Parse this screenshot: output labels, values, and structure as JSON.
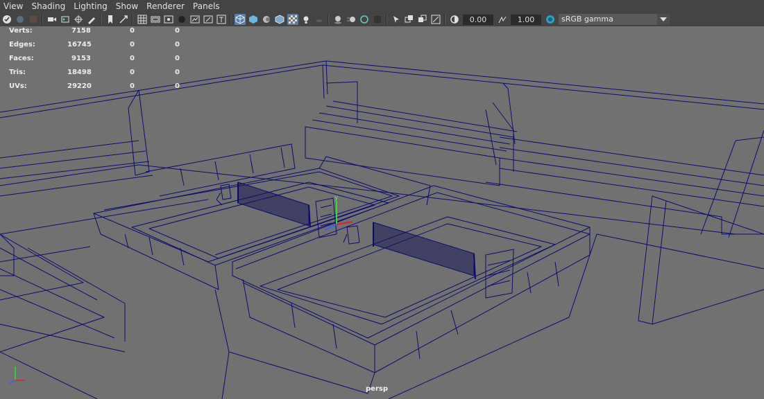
{
  "menu": [
    "View",
    "Shading",
    "Lighting",
    "Show",
    "Renderer",
    "Panels"
  ],
  "toolbar": {
    "exposure_value": "0.00",
    "gamma_value": "1.00",
    "color_space": "sRGB gamma"
  },
  "hud": [
    {
      "label": "Verts:",
      "values": [
        "7158",
        "0",
        "0"
      ]
    },
    {
      "label": "Edges:",
      "values": [
        "16745",
        "0",
        "0"
      ]
    },
    {
      "label": "Faces:",
      "values": [
        "9153",
        "0",
        "0"
      ]
    },
    {
      "label": "Tris:",
      "values": [
        "18498",
        "0",
        "0"
      ]
    },
    {
      "label": "UVs:",
      "values": [
        "29220",
        "0",
        "0"
      ]
    }
  ],
  "camera_label": "persp",
  "gizmo_axis_label": "y",
  "colors": {
    "wire": "#0c0c6e",
    "viewport_bg": "#717171",
    "active": "#5b7fa6"
  }
}
